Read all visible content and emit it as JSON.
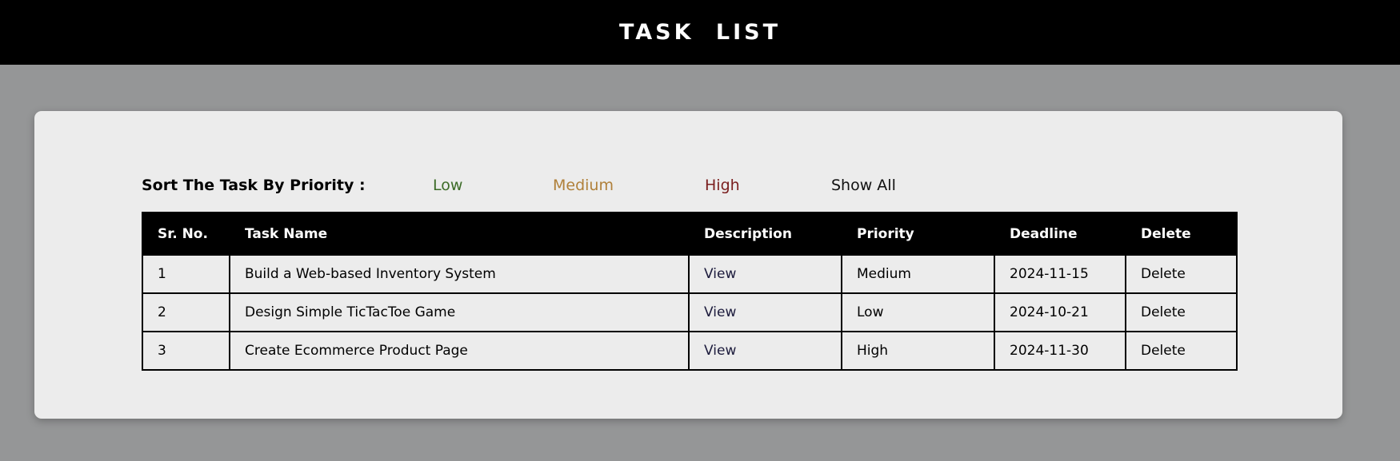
{
  "header": {
    "title": "TASK  LIST"
  },
  "sort": {
    "label": "Sort The Task By Priority :",
    "options": [
      {
        "label": "Low",
        "color": "#3c6b27"
      },
      {
        "label": "Medium",
        "color": "#b0803a"
      },
      {
        "label": "High",
        "color": "#7a1e1e"
      },
      {
        "label": "Show All",
        "color": "#111111"
      }
    ]
  },
  "table": {
    "headers": [
      "Sr. No.",
      "Task Name",
      "Description",
      "Priority",
      "Deadline",
      "Delete"
    ],
    "rows": [
      {
        "sr": "1",
        "name": "Build a Web-based Inventory System",
        "description": "View",
        "priority": "Medium",
        "deadline": "2024-11-15",
        "delete": "Delete"
      },
      {
        "sr": "2",
        "name": "Design Simple TicTacToe Game",
        "description": "View",
        "priority": "Low",
        "deadline": "2024-10-21",
        "delete": "Delete"
      },
      {
        "sr": "3",
        "name": "Create Ecommerce Product Page",
        "description": "View",
        "priority": "High",
        "deadline": "2024-11-30",
        "delete": "Delete"
      }
    ]
  }
}
